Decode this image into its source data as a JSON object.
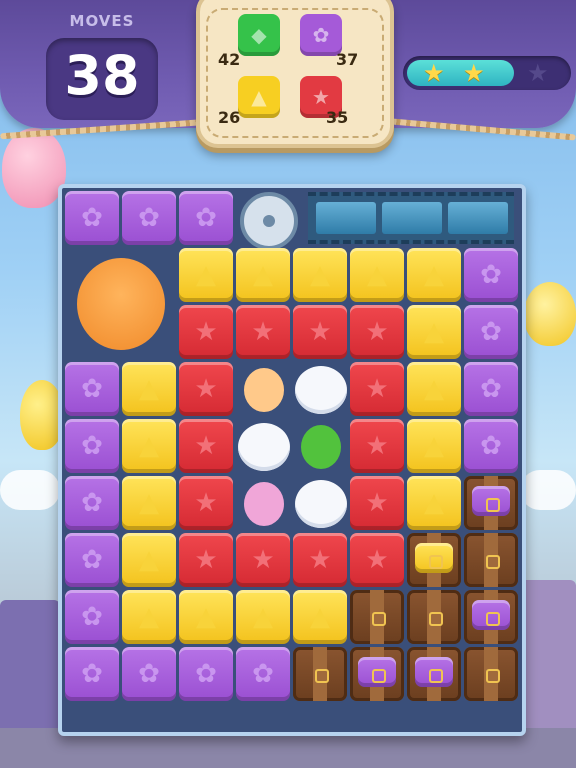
{
  "hud": {
    "moves_label": "MOVES",
    "moves_count": "38",
    "stars_earned": 2,
    "stars_total": 3,
    "goals": [
      {
        "name": "green",
        "count": "42",
        "color": "#35c24a"
      },
      {
        "name": "purple",
        "count": "37",
        "color": "#a55ad8"
      },
      {
        "name": "yellow",
        "count": "26",
        "color": "#f7cf22"
      },
      {
        "name": "red",
        "count": "35",
        "color": "#e23a42"
      }
    ]
  },
  "colors": {
    "purple": "#a55ad8",
    "yellow": "#f7cf22",
    "red": "#e23a42",
    "green": "#35c24a",
    "crate": "#7a4a26",
    "board_border": "#b6d3ef"
  },
  "board": {
    "columns": 8,
    "rows": 9,
    "rows_data": [
      [
        "P",
        "P",
        "P",
        "reel",
        "film",
        "film",
        "film",
        "film"
      ],
      [
        "tiger",
        "tiger",
        "Y",
        "Y",
        "Y",
        "Y",
        "Y",
        "P"
      ],
      [
        "tiger",
        "tiger",
        "R",
        "R",
        "R",
        "R",
        "Y",
        "P"
      ],
      [
        "P",
        "Y",
        "R",
        "girl",
        "cloud",
        "R",
        "Y",
        "P"
      ],
      [
        "P",
        "Y",
        "R",
        "cloud",
        "dino",
        "R",
        "Y",
        "P"
      ],
      [
        "P",
        "Y",
        "R",
        "unicorn",
        "cloud",
        "R",
        "Y",
        "crateP"
      ],
      [
        "P",
        "Y",
        "R",
        "R",
        "R",
        "R",
        "crateY",
        "crate"
      ],
      [
        "P",
        "Y",
        "Y",
        "Y",
        "Y",
        "crate",
        "crate",
        "crateP"
      ],
      [
        "P",
        "P",
        "P",
        "P",
        "crate",
        "crateP",
        "crateP",
        "crate"
      ]
    ]
  }
}
